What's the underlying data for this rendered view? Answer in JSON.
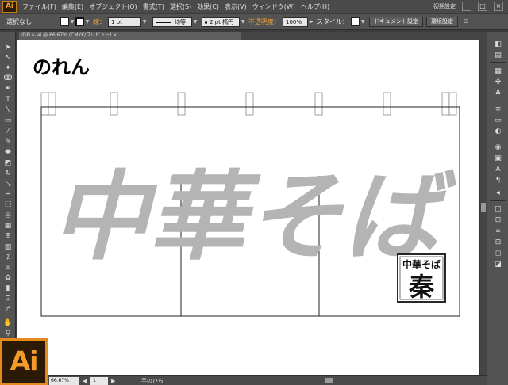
{
  "app": {
    "logo": "Ai",
    "workspace": "初期設定",
    "window_controls": [
      "−",
      "□",
      "×"
    ]
  },
  "menu": [
    "ファイル(F)",
    "編集(E)",
    "オブジェクト(O)",
    "書式(T)",
    "選択(S)",
    "効果(C)",
    "表示(V)",
    "ウィンドウ(W)",
    "ヘルプ(H)"
  ],
  "controlbar": {
    "selection": "選択なし",
    "stroke_label": "線：",
    "stroke_weight": "1 pt",
    "stroke_profile": "均等",
    "brush": "2 pt 楕円",
    "opacity_label": "不透明度：",
    "opacity_value": "100%",
    "style_label": "スタイル：",
    "doc_setup_button": "ドキュメント設定",
    "prefs_button": "環境設定"
  },
  "document": {
    "tab_label": "のれん.ai @ 66.67% (CMYK/プレビュー) ×",
    "title": "のれん",
    "main_text": "中華そば",
    "stamp_top": "中華そば",
    "stamp_kanji": "秦"
  },
  "status": {
    "zoom": "66.67%",
    "page": "1",
    "tool_name": "手のひら"
  },
  "colors": {
    "ui_dark": "#535353",
    "ai_orange": "#f59b2b",
    "calligraphy_gray": "#b4b4b4"
  },
  "icons": {
    "tools": [
      "selection-tool-icon",
      "direct-selection-tool-icon",
      "magic-wand-icon",
      "lasso-icon",
      "pen-tool-icon",
      "type-tool-icon",
      "line-tool-icon",
      "rectangle-tool-icon",
      "paintbrush-icon",
      "pencil-icon",
      "blob-brush-icon",
      "eraser-icon",
      "rotate-icon",
      "scale-icon",
      "warp-icon",
      "free-transform-icon",
      "shape-builder-icon",
      "perspective-grid-icon",
      "mesh-icon",
      "gradient-icon",
      "eyedropper-icon",
      "blend-icon",
      "symbol-sprayer-icon",
      "column-graph-icon",
      "artboard-icon",
      "slice-icon",
      "hand-tool-icon",
      "zoom-tool-icon"
    ],
    "panels": [
      "color-panel-icon",
      "color-guide-icon",
      "swatches-icon",
      "brushes-icon",
      "symbols-icon",
      "stroke-panel-icon",
      "gradient-panel-icon",
      "transparency-icon",
      "appearance-icon",
      "graphic-styles-icon",
      "character-icon",
      "paragraph-icon",
      "layers-icon",
      "artboards-icon",
      "links-icon"
    ]
  }
}
